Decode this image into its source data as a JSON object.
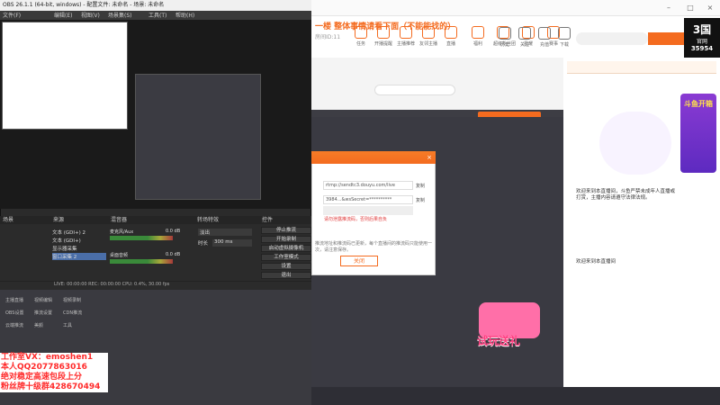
{
  "browser": {
    "room_title": "一楼 整体事情请看下面（不能能找的）",
    "room_id": "房间ID:11",
    "nav": [
      {
        "label": "任务"
      },
      {
        "label": "开播提醒"
      },
      {
        "label": "主播推荐"
      },
      {
        "label": "友邻主播"
      },
      {
        "label": "直播"
      },
      {
        "label": "福利"
      },
      {
        "label": "超级粉丝团"
      },
      {
        "label": "星耀"
      },
      {
        "label": "赛事"
      },
      {
        "label": "游戏中心"
      }
    ],
    "right_nav": [
      {
        "label": "历史"
      },
      {
        "label": "关注"
      },
      {
        "label": "充值"
      },
      {
        "label": "下载"
      },
      {
        "label": "私信"
      },
      {
        "label": "直播"
      },
      {
        "label": "客户端"
      }
    ],
    "search_label": "",
    "ad_text": "3国",
    "ad_sub": "官网",
    "ad_num": "35954"
  },
  "obs": {
    "title": "OBS 26.1.1 (64-bit, windows) - 配置文件: 未命名 - 场景: 未命名",
    "menu": [
      "文件(F)",
      "编辑(E)",
      "视图(V)",
      "场景集(S)",
      "工具(T)",
      "帮助(H)"
    ],
    "docks": {
      "scenes": "场景",
      "sources": "来源",
      "mixer": "混音器",
      "transitions": "转场特效",
      "controls": "控件"
    },
    "sources": [
      {
        "label": "文本 (GDI+) 2"
      },
      {
        "label": "文本 (GDI+)"
      },
      {
        "label": "显示器采集"
      },
      {
        "label": "窗口采集 2"
      }
    ],
    "mixer": [
      {
        "label": "麦克风/Aux",
        "value": "0.0 dB"
      },
      {
        "label": "桌面音频",
        "value": "0.0 dB"
      }
    ],
    "transition": {
      "name": "淡出",
      "duration_label": "时长",
      "duration": "300 ms"
    },
    "controls": [
      "停止推流",
      "开始录制",
      "启动虚拟摄像机",
      "工作室模式",
      "设置",
      "退出"
    ],
    "status": "LIVE: 00:00:00   REC: 00:00:00   CPU: 0.4%, 30.00 fps"
  },
  "lower_apps": [
    {
      "label": "主播直播"
    },
    {
      "label": "视频编辑"
    },
    {
      "label": "视频录制"
    },
    {
      "label": "OBS设置"
    },
    {
      "label": "推流设置"
    },
    {
      "label": "CDN推流"
    },
    {
      "label": "云端推流"
    },
    {
      "label": "美颜"
    },
    {
      "label": "工具"
    }
  ],
  "promo": {
    "line1": "工作室VX：emoshen1",
    "line2": "本人QQ2077863016",
    "line3": "绝对稳定高速包段上分",
    "line4": "粉丝牌十级群428670494"
  },
  "dialog": {
    "header": "",
    "field1": "rtmp://sendtc3.douyu.com/live",
    "field2": "3984...&wsSecret=**********",
    "field3": "",
    "copy": "复制",
    "warning": "请勿泄露推流码，否则后果自负",
    "tip": "推流地址和推流码已更新，每个直播间的推流码只能使用一次，请注意保存。",
    "ok": "关闭"
  },
  "chat": {
    "line1": "欢迎来到本直播间，斗鱼严禁未成年人直播或打赏，主播内容请遵守法律法规。",
    "line2": "欢迎来到本直播间"
  },
  "gift_banner": "试玩送礼",
  "douyu_promo": "斗鱼开箱"
}
